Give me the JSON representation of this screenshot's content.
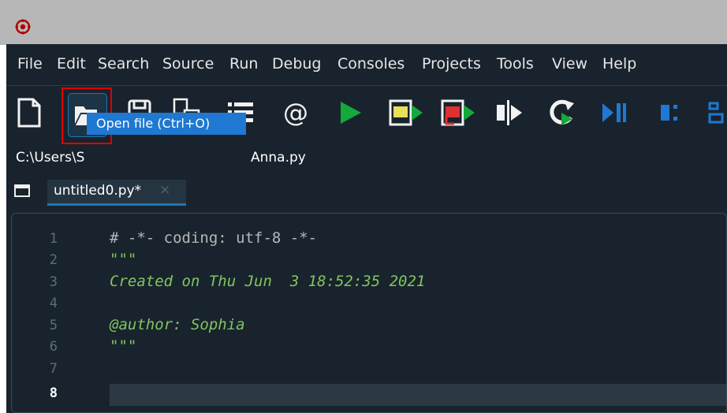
{
  "menu": {
    "items": [
      "File",
      "Edit",
      "Search",
      "Source",
      "Run",
      "Debug",
      "Consoles",
      "Projects",
      "Tools",
      "View",
      "Help"
    ]
  },
  "toolbar": {
    "icons": [
      "new-file-icon",
      "open-folder-icon",
      "save-icon",
      "save-all-icon",
      "outline-list-icon",
      "at-icon",
      "run-icon",
      "run-cell-icon",
      "run-cell-advance-icon",
      "run-selection-icon",
      "re-run-icon",
      "debug-icon",
      "debug-cell-icon",
      "debug-step-icon"
    ],
    "tooltip": "Open file (Ctrl+O)"
  },
  "path": {
    "left": "C:\\Users\\S",
    "right": "Anna.py"
  },
  "tab": {
    "label": "untitled0.py*",
    "close": "×"
  },
  "editor": {
    "line_numbers": [
      "1",
      "2",
      "3",
      "4",
      "5",
      "6",
      "7",
      "8"
    ],
    "current_line": "8",
    "lines": [
      "# -*- coding: utf-8 -*-",
      "\"\"\"",
      "Created on Thu Jun  3 18:52:35 2021",
      "",
      "@author: Sophia",
      "\"\"\"",
      "",
      ""
    ]
  },
  "colors": {
    "background": "#19232d",
    "accent": "#1f78b4",
    "highlight_border": "#e00000",
    "run_green": "#15a83a",
    "docstring": "#81c55f"
  }
}
